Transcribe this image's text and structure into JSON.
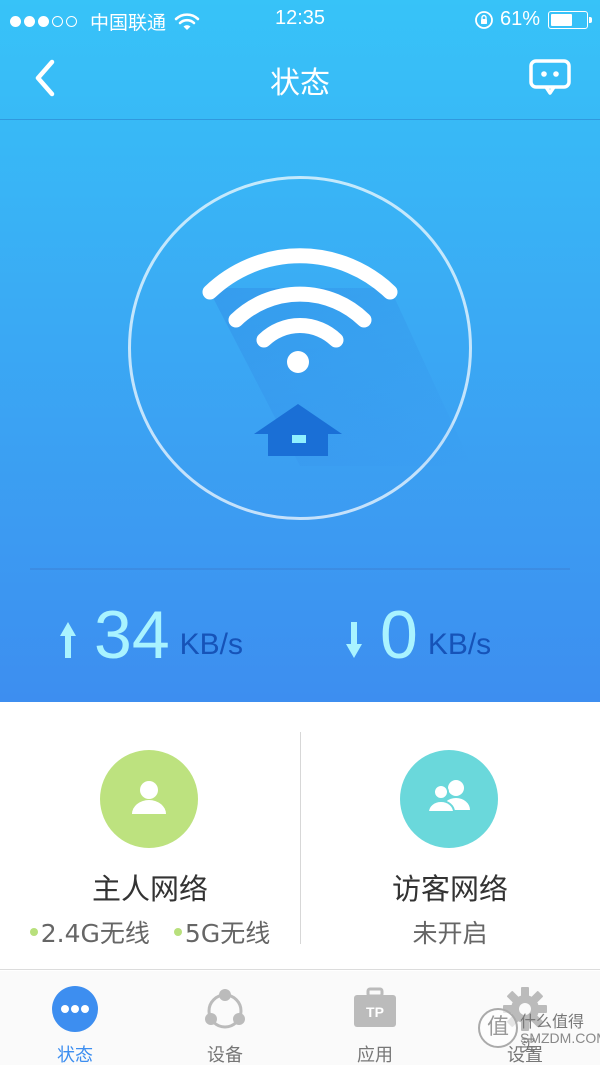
{
  "status_bar": {
    "signal_dots_full": 3,
    "signal_dots_total": 5,
    "carrier": "中国联通",
    "time": "12:35",
    "battery_percent": "61%",
    "battery_level": 0.61
  },
  "nav": {
    "title": "状态"
  },
  "speed": {
    "upload_value": "34",
    "upload_unit": "KB/s",
    "download_value": "0",
    "download_unit": "KB/s"
  },
  "networks": {
    "main": {
      "title": "主人网络",
      "band_24": "2.4G无线",
      "band_5": "5G无线"
    },
    "guest": {
      "title": "访客网络",
      "status": "未开启"
    }
  },
  "tabs": [
    {
      "label": "状态",
      "icon": "status-dots-icon",
      "active": true
    },
    {
      "label": "设备",
      "icon": "devices-icon",
      "active": false
    },
    {
      "label": "应用",
      "icon": "apps-toolbox-icon",
      "active": false
    },
    {
      "label": "设置",
      "icon": "gear-icon",
      "active": false
    }
  ],
  "watermark": {
    "glyph": "值",
    "text": "什么值得买",
    "sub": "SMZDM.COM"
  },
  "colors": {
    "hero_top": "#37c3f8",
    "hero_bottom": "#3d8ef0",
    "speed_value": "#a9f3ff",
    "speed_unit": "#1653b8",
    "main_network_circle": "#bde27f",
    "guest_network_circle": "#6ad8db",
    "active_tab": "#3d8ef0",
    "house": "#1a6fd6"
  }
}
